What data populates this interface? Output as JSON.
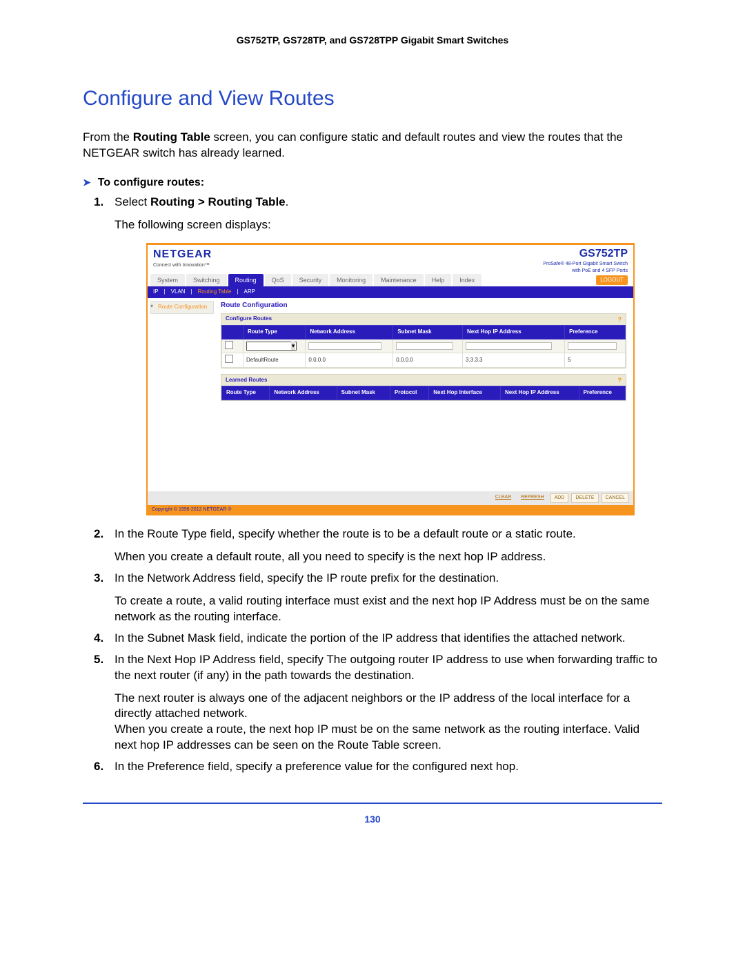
{
  "doc_header": "GS752TP, GS728TP, and GS728TPP Gigabit Smart Switches",
  "section_title": "Configure and View Routes",
  "intro_prefix": "From the ",
  "intro_bold": "Routing Table",
  "intro_suffix": " screen, you can configure static and default routes and view the routes that the NETGEAR switch has already learned.",
  "to_configure": "To configure routes:",
  "step1_prefix": "Select ",
  "step1_bold": "Routing > Routing Table",
  "step1_suffix": ".",
  "step1_after": "The following screen displays:",
  "screenshot": {
    "logo": "NETGEAR",
    "logo_sub": "Connect with Innovation™",
    "model": "GS752TP",
    "model_sub1": "ProSafe® 48-Port Gigabit Smart Switch",
    "model_sub2": "with PoE and 4 SFP Ports",
    "tabs": [
      "System",
      "Switching",
      "Routing",
      "QoS",
      "Security",
      "Monitoring",
      "Maintenance",
      "Help",
      "Index"
    ],
    "active_tab_index": 2,
    "logout": "LOGOUT",
    "subbar": [
      "IP",
      "VLAN",
      "Routing Table",
      "ARP"
    ],
    "subbar_active_index": 2,
    "side_item": "Route Configuration",
    "main_title": "Route Configuration",
    "panel1_title": "Configure Routes",
    "panel1_headers": [
      "",
      "Route Type",
      "Network Address",
      "Subnet Mask",
      "Next Hop IP Address",
      "Preference"
    ],
    "panel1_row": [
      "",
      "DefaultRoute",
      "0.0.0.0",
      "0.0.0.0",
      "3.3.3.3",
      "5"
    ],
    "panel2_title": "Learned Routes",
    "panel2_headers": [
      "Route Type",
      "Network Address",
      "Subnet Mask",
      "Protocol",
      "Next Hop Interface",
      "Next Hop IP Address",
      "Preference"
    ],
    "footer_buttons": [
      "CLEAR",
      "REFRESH",
      "ADD",
      "DELETE",
      "CANCEL"
    ],
    "copyright": "Copyright © 1996-2012 NETGEAR ®"
  },
  "step2": "In the Route Type field, specify whether the route is to be a default route or a static route.",
  "step2_after": "When you create a default route, all you need to specify is the next hop IP address.",
  "step3": "In the Network Address field, specify the IP route prefix for the destination.",
  "step3_after": "To create a route, a valid routing interface must exist and the next hop IP Address must be on the same network as the routing interface.",
  "step4": "In the Subnet Mask field, indicate the portion of the IP address that identifies the attached network.",
  "step5": "In the Next Hop IP Address field, specify The outgoing router IP address to use when forwarding traffic to the next router (if any) in the path towards the destination.",
  "step5_after1": "The next router is always one of the adjacent neighbors or the IP address of the local interface for a directly attached network.",
  "step5_after2": "When you create a route, the next hop IP must be on the same network as the routing interface. Valid next hop IP addresses can be seen on the Route Table screen.",
  "step6": "In the Preference field, specify a preference value for the configured next hop.",
  "page_number": "130"
}
